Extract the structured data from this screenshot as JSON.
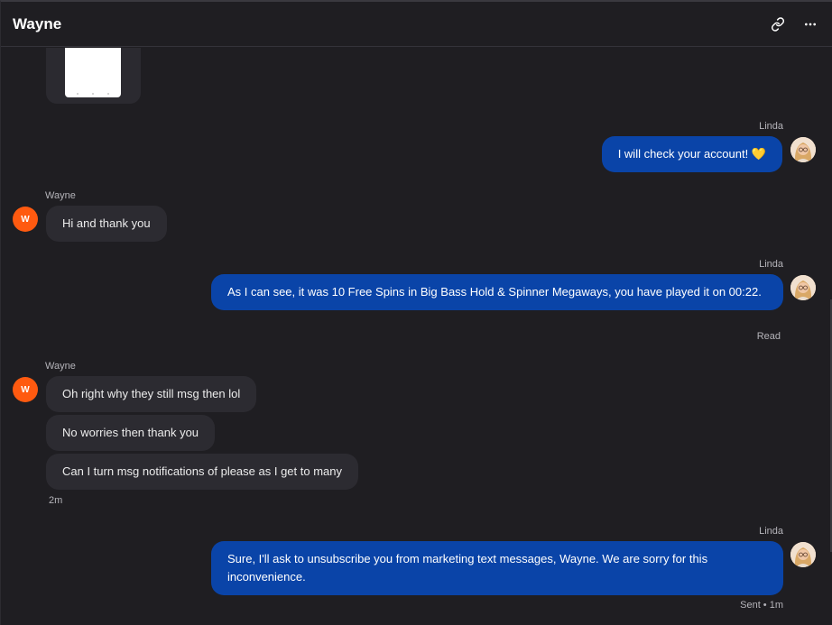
{
  "header": {
    "title": "Wayne",
    "link_icon": "link-icon",
    "more_icon": "more-horizontal-icon"
  },
  "colors": {
    "background": "#1f1e22",
    "incoming_bubble": "#2c2b31",
    "outgoing_bubble": "#0a44a8",
    "wayne_avatar": "#ff5a10"
  },
  "wayne_avatar_initial": "W",
  "messages": [
    {
      "sender": "Linda",
      "text": "I will check your account! 💛"
    },
    {
      "sender": "Wayne",
      "text": "Hi and thank you"
    },
    {
      "sender": "Linda",
      "text": "As I can see, it was 10 Free Spins in Big Bass Hold & Spinner Megaways, you have played it on 00:22.",
      "status": "Read"
    },
    {
      "sender": "Wayne",
      "text": "Oh right why they still msg then lol"
    },
    {
      "sender": "Wayne",
      "text": "No worries then thank you"
    },
    {
      "sender": "Wayne",
      "text": "Can I turn msg notifications of please as I get to many",
      "time": "2m"
    },
    {
      "sender": "Linda",
      "text": "Sure, I'll ask to unsubscribe you from marketing text messages, Wayne. We are sorry for this inconvenience.",
      "status": "Sent • 1m"
    }
  ]
}
